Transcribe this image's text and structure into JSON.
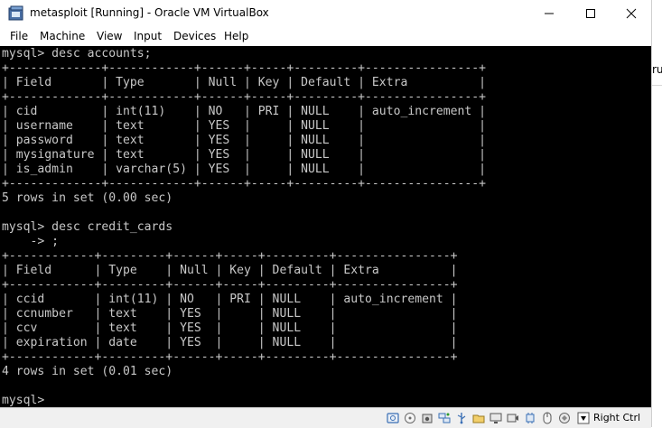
{
  "window": {
    "title": "metasploit [Running] - Oracle VM VirtualBox",
    "icon": "virtualbox-icon"
  },
  "title_buttons": {
    "minimize_icon": "minimize-icon",
    "maximize_icon": "maximize-icon",
    "close_icon": "close-icon"
  },
  "menu": {
    "items": [
      "File",
      "Machine",
      "View",
      "Input",
      "Devices",
      "Help"
    ]
  },
  "console": {
    "text_color": "#c8c8c8",
    "background": "#000000",
    "lines": [
      "mysql> desc accounts;",
      "+-------------+------------+------+-----+---------+----------------+",
      "| Field       | Type       | Null | Key | Default | Extra          |",
      "+-------------+------------+------+-----+---------+----------------+",
      "| cid         | int(11)    | NO   | PRI | NULL    | auto_increment |",
      "| username    | text       | YES  |     | NULL    |                |",
      "| password    | text       | YES  |     | NULL    |                |",
      "| mysignature | text       | YES  |     | NULL    |                |",
      "| is_admin    | varchar(5) | YES  |     | NULL    |                |",
      "+-------------+------------+------+-----+---------+----------------+",
      "5 rows in set (0.00 sec)",
      "",
      "mysql> desc credit_cards",
      "    -> ;",
      "+------------+---------+------+-----+---------+----------------+",
      "| Field      | Type    | Null | Key | Default | Extra          |",
      "+------------+---------+------+-----+---------+----------------+",
      "| ccid       | int(11) | NO   | PRI | NULL    | auto_increment |",
      "| ccnumber   | text    | YES  |     | NULL    |                |",
      "| ccv        | text    | YES  |     | NULL    |                |",
      "| expiration | date    | YES  |     | NULL    |                |",
      "+------------+---------+------+-----+---------+----------------+",
      "4 rows in set (0.01 sec)",
      "",
      "mysql>"
    ]
  },
  "statusbar": {
    "icons": [
      "hard-disk-icon",
      "optical-drive-icon",
      "audio-icon",
      "network-icon",
      "usb-icon",
      "shared-folders-icon",
      "display-icon",
      "video-capture-icon",
      "cpu-icon",
      "mouse-integration-icon",
      "keyboard-capture-icon"
    ],
    "host_key": "Right Ctrl"
  },
  "side_strip": {
    "text": "ru"
  }
}
